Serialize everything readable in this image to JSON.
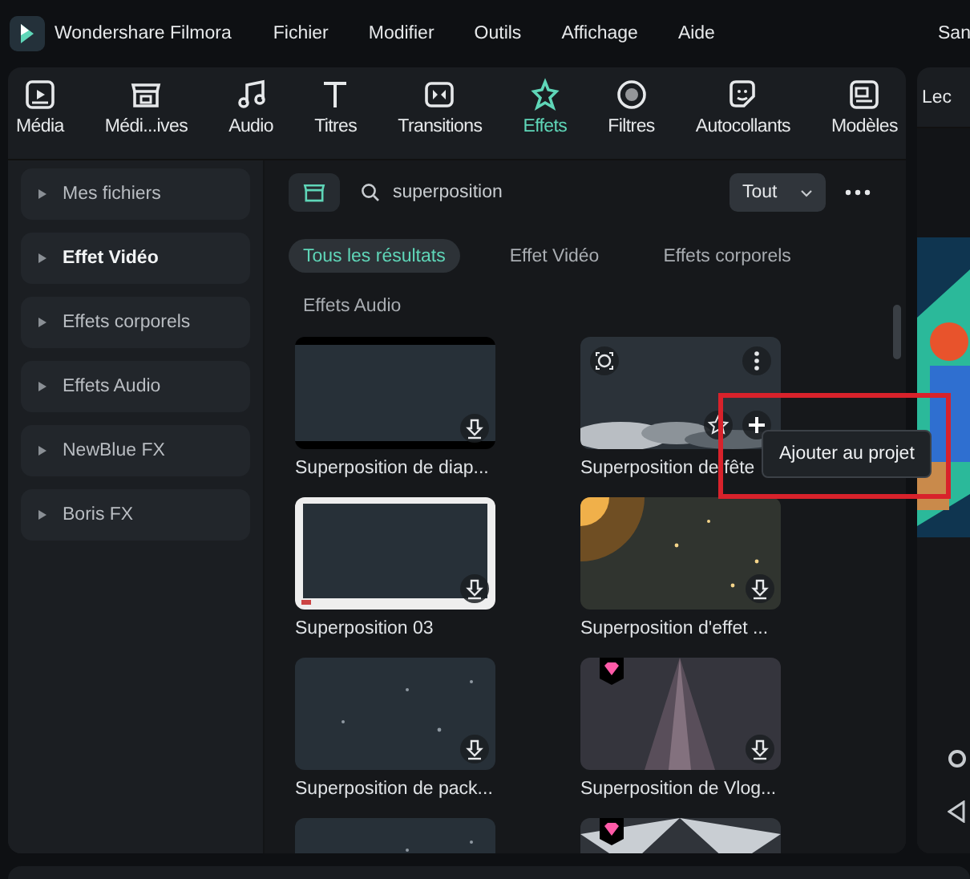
{
  "app": {
    "title": "Wondershare Filmora",
    "project": "San"
  },
  "menu": [
    "Fichier",
    "Modifier",
    "Outils",
    "Affichage",
    "Aide"
  ],
  "toolbar": [
    {
      "label": "Média",
      "selected": false
    },
    {
      "label": "Médi...ives",
      "selected": false
    },
    {
      "label": "Audio",
      "selected": false
    },
    {
      "label": "Titres",
      "selected": false
    },
    {
      "label": "Transitions",
      "selected": false
    },
    {
      "label": "Effets",
      "selected": true
    },
    {
      "label": "Filtres",
      "selected": false
    },
    {
      "label": "Autocollants",
      "selected": false
    },
    {
      "label": "Modèles",
      "selected": false
    }
  ],
  "sidebar": [
    {
      "label": "Mes fichiers",
      "selected": false
    },
    {
      "label": "Effet Vidéo",
      "selected": true
    },
    {
      "label": "Effets corporels",
      "selected": false
    },
    {
      "label": "Effets Audio",
      "selected": false
    },
    {
      "label": "NewBlue FX",
      "selected": false
    },
    {
      "label": "Boris FX",
      "selected": false
    }
  ],
  "search": {
    "value": "superposition"
  },
  "filter": {
    "value": "Tout"
  },
  "result_tabs": [
    {
      "label": "Tous les résultats",
      "selected": true
    },
    {
      "label": "Effet Vidéo",
      "selected": false
    },
    {
      "label": "Effets corporels",
      "selected": false
    },
    {
      "label": "Effets Audio",
      "selected": false
    }
  ],
  "results": [
    {
      "title": "Superposition de diap...",
      "premium": false,
      "hovered": false
    },
    {
      "title": "Superposition de fête",
      "premium": false,
      "hovered": true
    },
    {
      "title": "Superposition 03",
      "premium": false,
      "hovered": false
    },
    {
      "title": "Superposition d'effet ...",
      "premium": false,
      "hovered": false
    },
    {
      "title": "Superposition de pack...",
      "premium": false,
      "hovered": false
    },
    {
      "title": "Superposition de Vlog...",
      "premium": true,
      "hovered": false
    },
    {
      "premium": false,
      "hovered": false
    },
    {
      "premium": true,
      "hovered": false
    }
  ],
  "tooltip": "Ajouter au projet",
  "callout_frame": true,
  "preview": {
    "label": "Lec"
  }
}
